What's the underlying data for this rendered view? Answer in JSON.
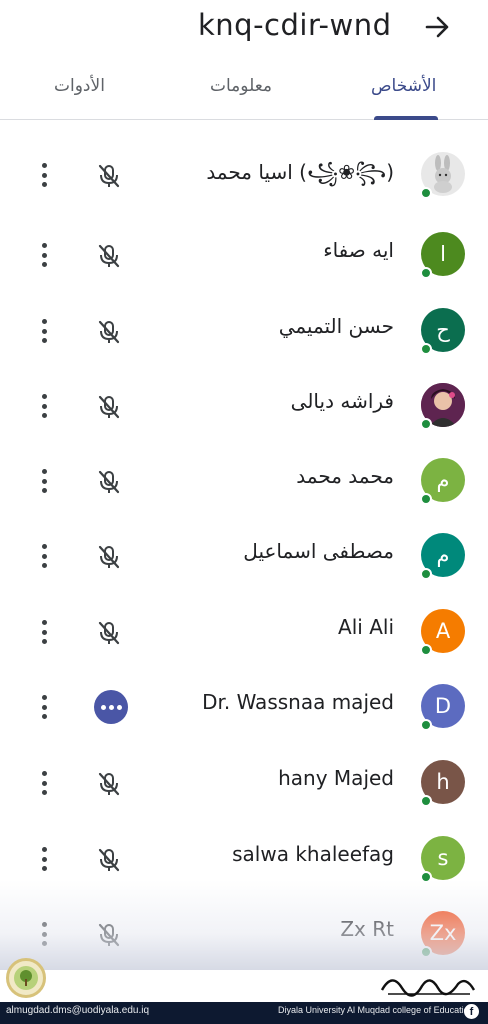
{
  "header": {
    "meeting_code": "knq-cdir-wnd",
    "arrow_icon": "arrow-right-icon"
  },
  "tabs": [
    {
      "label": "الأدوات"
    },
    {
      "label": "معلومات"
    },
    {
      "label": "الأشخاص",
      "active": true
    }
  ],
  "participants": [
    {
      "name": "اسيا محمد (꧁❀꧂)",
      "initial": "",
      "avatar_color": "#e8e8e8",
      "avatar_icon": "bunny-avatar-icon",
      "mic": "muted"
    },
    {
      "name": "ايه صفاء",
      "initial": "ا",
      "avatar_color": "#4d8a1f",
      "mic": "muted"
    },
    {
      "name": "حسن التميمي",
      "initial": "ح",
      "avatar_color": "#0b6e4f",
      "mic": "muted"
    },
    {
      "name": "فراشه ديالى",
      "initial": "",
      "avatar_color": "#6b2a5a",
      "avatar_icon": "photo-avatar-icon",
      "mic": "muted"
    },
    {
      "name": "محمد محمد",
      "initial": "م",
      "avatar_color": "#7cb342",
      "mic": "muted"
    },
    {
      "name": "مصطفى اسماعيل",
      "initial": "م",
      "avatar_color": "#00897b",
      "mic": "muted"
    },
    {
      "name": "Ali Ali",
      "initial": "A",
      "avatar_color": "#f57c00",
      "mic": "muted"
    },
    {
      "name": "Dr. Wassnaa majed",
      "initial": "D",
      "avatar_color": "#5c6bc0",
      "mic": "speaking"
    },
    {
      "name": "hany Majed",
      "initial": "h",
      "avatar_color": "#795548",
      "mic": "muted"
    },
    {
      "name": "salwa khaleefag",
      "initial": "s",
      "avatar_color": "#7cb342",
      "mic": "muted"
    },
    {
      "name": "Zx Rt",
      "initial": "Zx",
      "avatar_color": "#f4511e",
      "mic": "muted"
    }
  ],
  "footer": {
    "email": "almugdad.dms@uodiyala.edu.iq",
    "college": "Diyala University Al Muqdad college of Education",
    "facebook_icon": "f",
    "logo_text": "كليةالتربية المقداد"
  },
  "colors": {
    "accent": "#3b4a8a",
    "status_online": "#1e8e3e"
  }
}
